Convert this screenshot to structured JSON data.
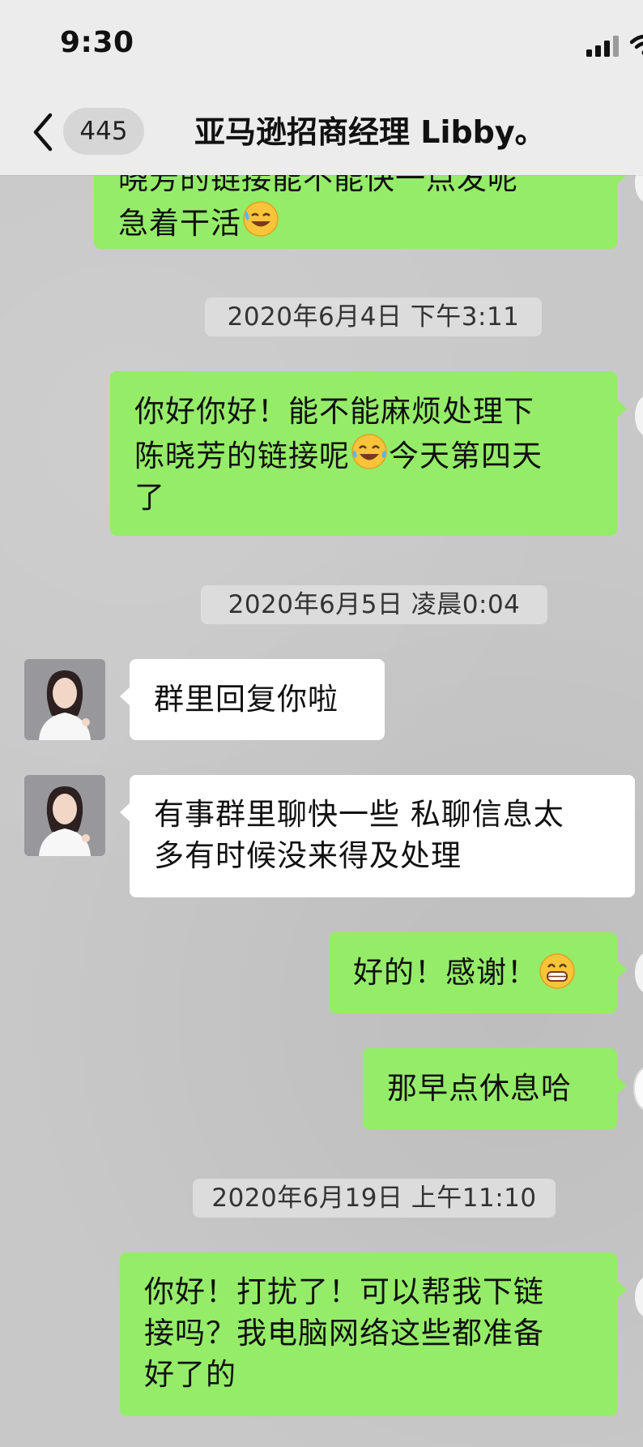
{
  "status_bar": {
    "time": "9:30"
  },
  "header": {
    "badge_count": "445",
    "title": "亚马逊招商经理 Libby。"
  },
  "messages": {
    "m0": {
      "line1": "晓芳的链接能不能快一点发呢",
      "line2": "急着干活",
      "emoji": "sweat-smile-emoji"
    },
    "t1": "2020年6月4日 下午3:11",
    "m1": {
      "line1": "你好你好！能不能麻烦处理下",
      "line2a": "陈晓芳的链接呢",
      "line2b": "今天第四天",
      "line3": "了",
      "emoji": "tears-of-joy-emoji"
    },
    "t2": "2020年6月5日 凌晨0:04",
    "m2": {
      "text": "群里回复你啦"
    },
    "m3": {
      "line1": "有事群里聊快一些 私聊信息太",
      "line2": "多有时候没来得及处理"
    },
    "m4": {
      "text": "好的！感谢！",
      "emoji": "grinning-emoji"
    },
    "m5": {
      "text": "那早点休息哈"
    },
    "t3": "2020年6月19日 上午11:10",
    "m6": {
      "line1": "你好！打扰了！可以帮我下链",
      "line2": "接吗？我电脑网络这些都准备",
      "line3": "好了的"
    }
  },
  "colors": {
    "sent_bubble": "#95ec69",
    "received_bubble": "#ffffff",
    "chat_background": "#c8c8c8",
    "header": "#ececec"
  }
}
